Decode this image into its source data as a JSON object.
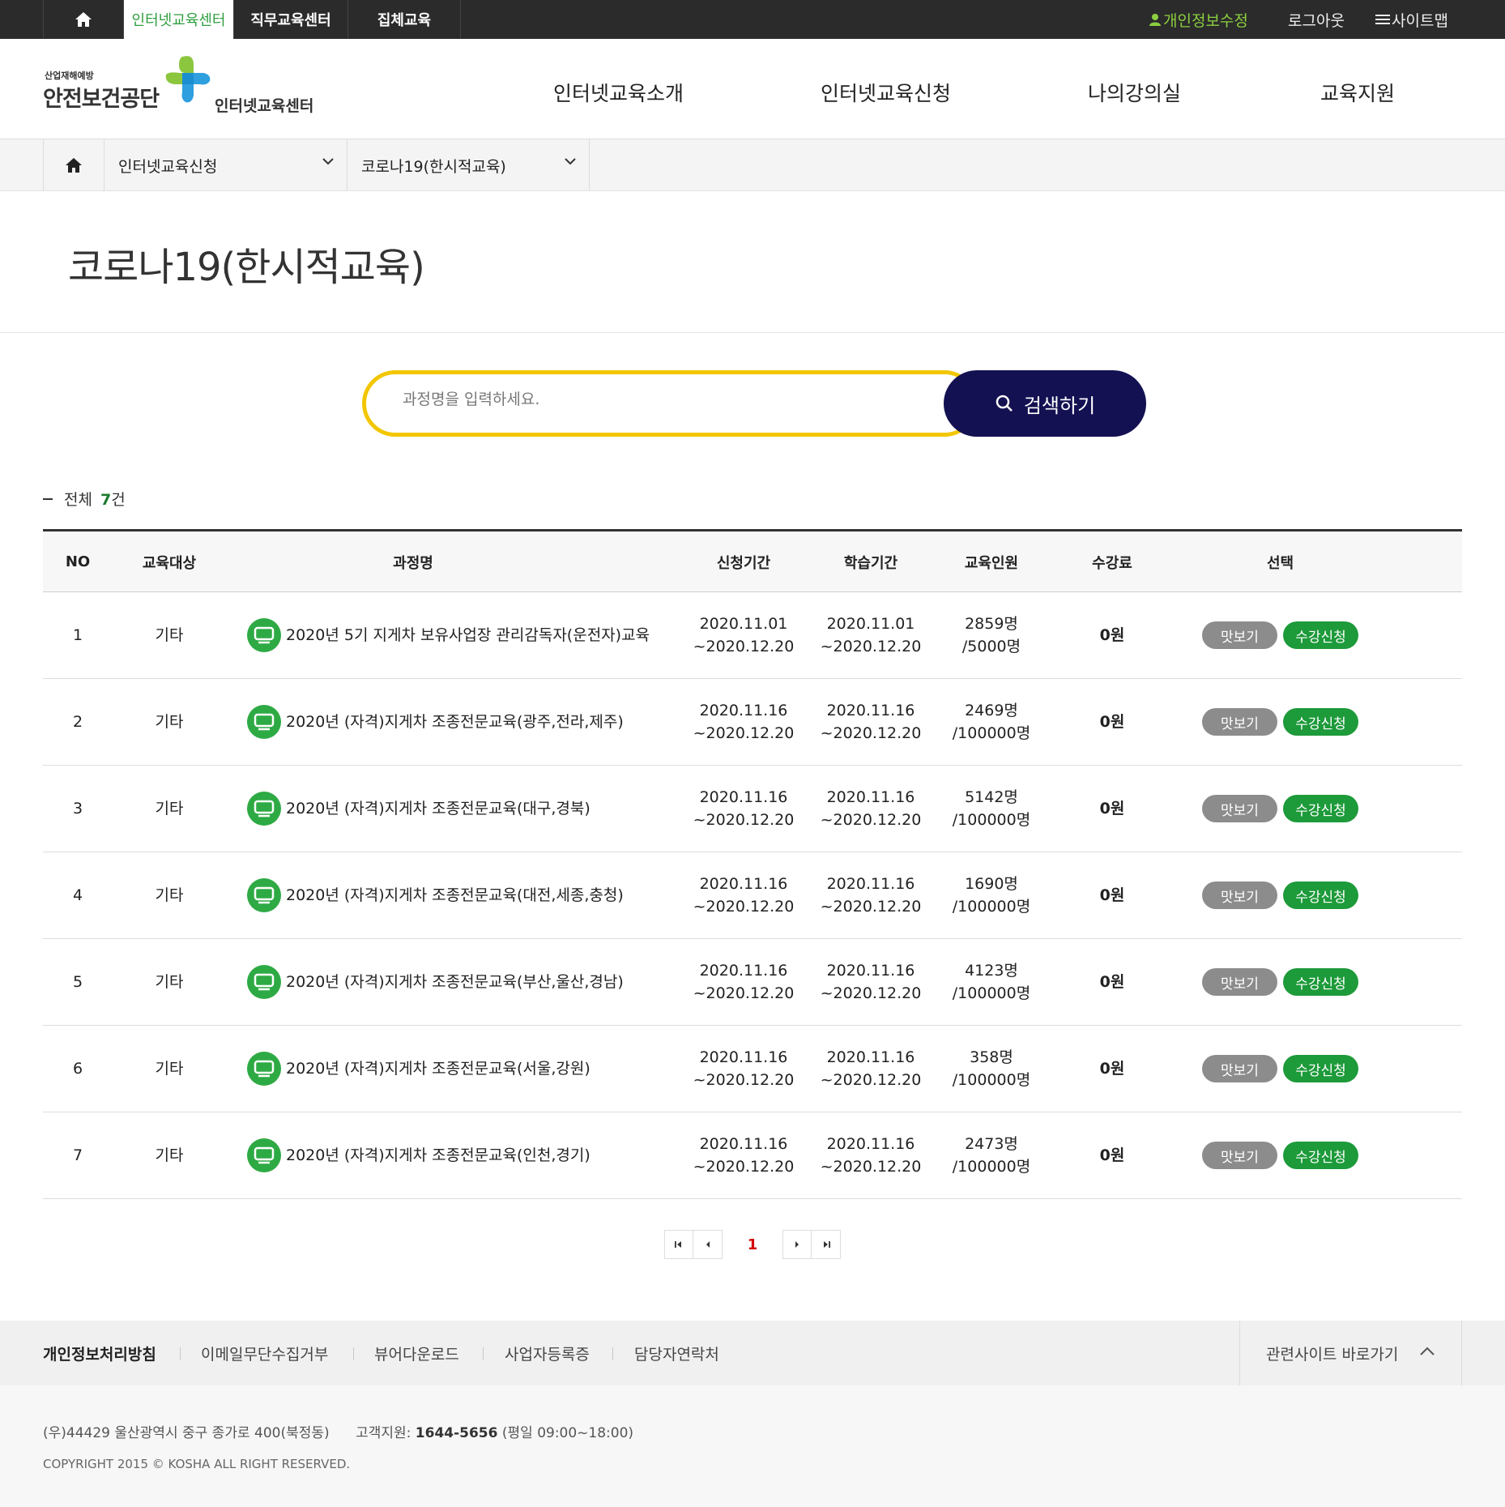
{
  "topbar": {
    "tabs": [
      "인터넷교육센터",
      "직무교육센터",
      "집체교육"
    ],
    "right": [
      "개인정보수정",
      "로그아웃",
      "사이트맵"
    ]
  },
  "logo": {
    "small": "산업재해예방",
    "main": "안전보건공단",
    "sub": "인터넷교육센터"
  },
  "gnb": [
    "인터넷교육소개",
    "인터넷교육신청",
    "나의강의실",
    "교육지원"
  ],
  "breadcrumb": [
    "인터넷교육신청",
    "코로나19(한시적교육)"
  ],
  "page_title": "코로나19(한시적교육)",
  "search": {
    "placeholder": "과정명을 입력하세요.",
    "button": "검색하기"
  },
  "count": {
    "label": "전체",
    "value": "7",
    "unit": "건"
  },
  "table": {
    "headers": [
      "NO",
      "교육대상",
      "과정명",
      "신청기간",
      "학습기간",
      "교육인원",
      "수강료",
      "선택"
    ],
    "rows": [
      {
        "no": "1",
        "target": "기타",
        "title": "2020년 5기 지게차 보유사업장 관리감독자(운전자)교육",
        "apply_start": "2020.11.01",
        "apply_end": "~2020.12.20",
        "study_start": "2020.11.01",
        "study_end": "~2020.12.20",
        "enrolled": "2859명",
        "capacity": "/5000명",
        "fee": "0원"
      },
      {
        "no": "2",
        "target": "기타",
        "title": "2020년 (자격)지게차 조종전문교육(광주,전라,제주)",
        "apply_start": "2020.11.16",
        "apply_end": "~2020.12.20",
        "study_start": "2020.11.16",
        "study_end": "~2020.12.20",
        "enrolled": "2469명",
        "capacity": "/100000명",
        "fee": "0원"
      },
      {
        "no": "3",
        "target": "기타",
        "title": "2020년 (자격)지게차 조종전문교육(대구,경북)",
        "apply_start": "2020.11.16",
        "apply_end": "~2020.12.20",
        "study_start": "2020.11.16",
        "study_end": "~2020.12.20",
        "enrolled": "5142명",
        "capacity": "/100000명",
        "fee": "0원"
      },
      {
        "no": "4",
        "target": "기타",
        "title": "2020년 (자격)지게차 조종전문교육(대전,세종,충청)",
        "apply_start": "2020.11.16",
        "apply_end": "~2020.12.20",
        "study_start": "2020.11.16",
        "study_end": "~2020.12.20",
        "enrolled": "1690명",
        "capacity": "/100000명",
        "fee": "0원"
      },
      {
        "no": "5",
        "target": "기타",
        "title": "2020년 (자격)지게차 조종전문교육(부산,울산,경남)",
        "apply_start": "2020.11.16",
        "apply_end": "~2020.12.20",
        "study_start": "2020.11.16",
        "study_end": "~2020.12.20",
        "enrolled": "4123명",
        "capacity": "/100000명",
        "fee": "0원"
      },
      {
        "no": "6",
        "target": "기타",
        "title": "2020년 (자격)지게차 조종전문교육(서울,강원)",
        "apply_start": "2020.11.16",
        "apply_end": "~2020.12.20",
        "study_start": "2020.11.16",
        "study_end": "~2020.12.20",
        "enrolled": "358명",
        "capacity": "/100000명",
        "fee": "0원"
      },
      {
        "no": "7",
        "target": "기타",
        "title": "2020년 (자격)지게차 조종전문교육(인천,경기)",
        "apply_start": "2020.11.16",
        "apply_end": "~2020.12.20",
        "study_start": "2020.11.16",
        "study_end": "~2020.12.20",
        "enrolled": "2473명",
        "capacity": "/100000명",
        "fee": "0원"
      }
    ],
    "preview_label": "맛보기",
    "apply_label": "수강신청"
  },
  "pagination": {
    "current": "1"
  },
  "footer": {
    "links": [
      "개인정보처리방침",
      "이메일무단수집거부",
      "뷰어다운로드",
      "사업자등록증",
      "담당자연락처"
    ],
    "related": "관련사이트 바로가기",
    "address": "(우)44429 울산광역시 중구 종가로 400(북정동)",
    "support_label": "고객지원:",
    "support_phone": "1644-5656",
    "support_hours": "(평일 09:00~18:00)",
    "copyright": "COPYRIGHT 2015 © KOSHA ALL RIGHT RESERVED."
  },
  "colors": {
    "topbar": "#2b2b2b",
    "accent_green": "#2e9e3f",
    "search_border": "#f2c600",
    "search_button": "#131152",
    "apply_button": "#1d9a3a",
    "preview_button": "#8c8c8c",
    "current_page": "#d40000"
  }
}
